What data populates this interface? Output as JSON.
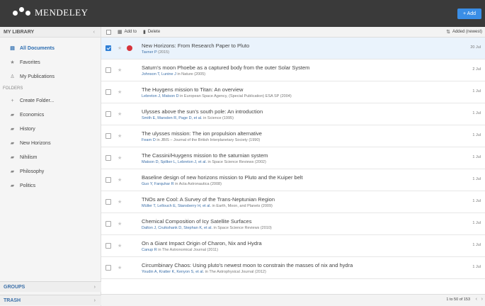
{
  "app": {
    "name": "MENDELEY",
    "add_label": "+ Add"
  },
  "sidebar": {
    "my_library": "MY LIBRARY",
    "items": [
      {
        "label": "All Documents",
        "icon": "documents-icon"
      },
      {
        "label": "Favorites",
        "icon": "star-icon"
      },
      {
        "label": "My Publications",
        "icon": "person-icon"
      }
    ],
    "folders_label": "FOLDERS",
    "create_folder": "Create Folder...",
    "folders": [
      "Economics",
      "History",
      "New Horizons",
      "Nihilism",
      "Philosophy",
      "Politics"
    ],
    "groups": "GROUPS",
    "trash": "TRASH"
  },
  "toolbar": {
    "add_to": "Add to",
    "delete": "Delete",
    "sort": "Added (newest)"
  },
  "documents": [
    {
      "title": "New Horizons: From Research Paper to Pluto",
      "authors": "Tavner P",
      "source": " (2015)",
      "date": "20 Jul",
      "selected": true,
      "pdf": true
    },
    {
      "title": "Saturn's moon Phoebe as a captured body from the outer Solar System",
      "authors": "Johnson T, Lunine J",
      "source": " in Nature (2005)",
      "date": "2 Jul",
      "selected": false,
      "pdf": false
    },
    {
      "title": "The Huygens mission to Titan: An overview",
      "authors": "Lebreton J, Matson D",
      "source": " in European Space Agency, (Special Publication) ESA SP (2004)",
      "date": "1 Jul",
      "selected": false,
      "pdf": false
    },
    {
      "title": "Ulysses above the sun's south pole: An introduction",
      "authors": "Smith E, Marsden R, Page D, et al.",
      "source": " in Science (1995)",
      "date": "1 Jul",
      "selected": false,
      "pdf": false
    },
    {
      "title": "The ulysses mission: The ion propulsion alternative",
      "authors": "Fearn D",
      "source": " in JBIS – Journal of the British Interplanetary Society (1990)",
      "date": "1 Jul",
      "selected": false,
      "pdf": false
    },
    {
      "title": "The Cassini/Huygens mission to the saturnian system",
      "authors": "Matson D, Spilker L, Lebreton J, et al.",
      "source": " in Space Science Reviews (2002)",
      "date": "1 Jul",
      "selected": false,
      "pdf": false
    },
    {
      "title": "Baseline design of new horizons mission to Pluto and the Kuiper belt",
      "authors": "Guo Y, Farquhar R",
      "source": " in Acta Astronautica (2008)",
      "date": "1 Jul",
      "selected": false,
      "pdf": false
    },
    {
      "title": "TNOs are Cool: A Survey of the Trans-Neptunian Region",
      "authors": "Müller T, Lellouch E, Stansberry H, et al.",
      "source": " in Earth, Moon, and Planets (2009)",
      "date": "1 Jul",
      "selected": false,
      "pdf": false
    },
    {
      "title": "Chemical Composition of Icy Satellite Surfaces",
      "authors": "Dalton J, Cruikshank D, Stephan K, et al.",
      "source": " in Space Science Reviews (2010)",
      "date": "1 Jul",
      "selected": false,
      "pdf": false
    },
    {
      "title": "On a Giant Impact Origin of Charon, Nix and Hydra",
      "authors": "Canup R",
      "source": " in The Astronomical Journal (2011)",
      "date": "1 Jul",
      "selected": false,
      "pdf": false
    },
    {
      "title": "Circumbinary Chaos: Using pluto's newest moon to constrain the masses of nix and hydra",
      "authors": "Youdin A, Kratter K, Kenyon S, et al.",
      "source": " in The Astrophysical Journal (2012)",
      "date": "1 Jul",
      "selected": false,
      "pdf": false
    }
  ],
  "pager": {
    "text": "1 to 50 of 153"
  },
  "colors": {
    "topbar": "#3a3a3a",
    "accent": "#3a8ee6",
    "link": "#3b6fa8",
    "pdf": "#d6333b"
  }
}
